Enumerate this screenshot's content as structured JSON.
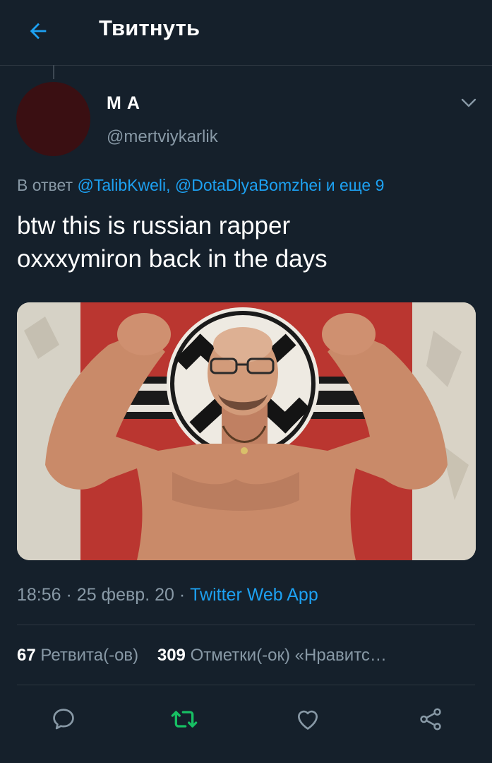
{
  "header": {
    "title": "Твитнуть",
    "back_icon": "arrow-left-icon"
  },
  "author": {
    "name": "M A",
    "handle": "@mertviykarlik",
    "avatar_color": "#3a0f12"
  },
  "reply": {
    "prefix": "В ответ",
    "mention_1": "@TalibKweli,",
    "mention_2": "@DotaDlyaBomzhei",
    "more": "и еще 9"
  },
  "tweet": {
    "text_line1": "btw this is russian rapper",
    "text_line2": "oxxxymiron back in the days"
  },
  "meta": {
    "time": "18:56",
    "sep1": "·",
    "date": "25 февр. 20",
    "sep2": "·",
    "source": "Twitter Web App"
  },
  "stats": {
    "retweets_count": "67",
    "retweets_label": "Ретвита(-ов)",
    "likes_count": "309",
    "likes_label": "Отметки(-ок) «Нравитс…"
  },
  "actions": {
    "reply_icon": "reply-bubble-icon",
    "retweet_icon": "retweet-icon",
    "like_icon": "heart-icon",
    "share_icon": "share-icon"
  },
  "colors": {
    "background": "#15202b",
    "accent": "#1da1f2",
    "secondary_text": "#8899a6",
    "retweet_green": "#17bf63"
  }
}
